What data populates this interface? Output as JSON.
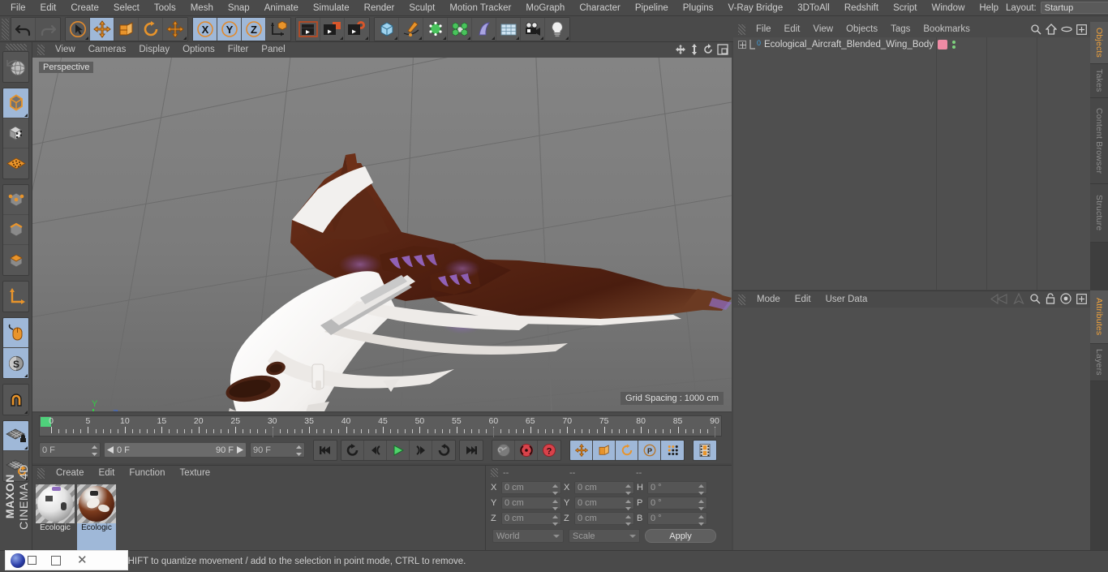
{
  "app": {
    "brand_line1": "MAXON",
    "brand_line2": "CINEMA 4D"
  },
  "menubar": {
    "items": [
      "File",
      "Edit",
      "Create",
      "Select",
      "Tools",
      "Mesh",
      "Snap",
      "Animate",
      "Simulate",
      "Render",
      "Sculpt",
      "Motion Tracker",
      "MoGraph",
      "Character",
      "Pipeline",
      "Plugins",
      "V-Ray Bridge",
      "3DToAll",
      "Redshift",
      "Script",
      "Window",
      "Help"
    ],
    "layout_label": "Layout:",
    "layout_value": "Startup",
    "search_icon": "search-icon"
  },
  "toolbar": {
    "groups": [
      {
        "name": "undo-redo",
        "buttons": [
          {
            "name": "undo-button",
            "icon": "undo-arrow-icon",
            "active": false
          },
          {
            "name": "redo-button",
            "icon": "redo-arrow-icon",
            "active": false,
            "disabled": true
          }
        ]
      },
      {
        "name": "transform-tools",
        "buttons": [
          {
            "name": "select-tool",
            "icon": "cursor-circle-icon",
            "active": false
          },
          {
            "name": "move-tool",
            "icon": "move-arrows-icon",
            "active": true
          },
          {
            "name": "scale-tool",
            "icon": "scale-box-icon",
            "active": false
          },
          {
            "name": "rotate-tool",
            "icon": "rotate-circle-icon",
            "active": false
          },
          {
            "name": "dynamic-place-tool",
            "icon": "move-arrows-icon",
            "active": false
          }
        ]
      },
      {
        "name": "axis-locks",
        "buttons": [
          {
            "name": "lock-x-axis",
            "icon": "x-axis-icon",
            "active": true
          },
          {
            "name": "lock-y-axis",
            "icon": "y-axis-icon",
            "active": true
          },
          {
            "name": "lock-z-axis",
            "icon": "z-axis-icon",
            "active": true
          },
          {
            "name": "world-object-axis",
            "icon": "world-axis-cube-icon",
            "active": false
          }
        ]
      },
      {
        "name": "render-tools",
        "buttons": [
          {
            "name": "render-view-button",
            "icon": "render-clapper-icon",
            "active": false
          },
          {
            "name": "render-to-picture-viewer-button",
            "icon": "render-picture-icon",
            "active": false
          },
          {
            "name": "render-settings-button",
            "icon": "render-gear-icon",
            "active": false
          }
        ]
      },
      {
        "name": "create-objects",
        "buttons": [
          {
            "name": "add-cube-button",
            "icon": "cube-icon",
            "active": false
          },
          {
            "name": "add-spline-button",
            "icon": "pen-spline-icon",
            "active": false
          },
          {
            "name": "add-generator-button",
            "icon": "green-cube-icon",
            "active": false
          },
          {
            "name": "add-mograph-button",
            "icon": "cloner-icon",
            "active": false
          },
          {
            "name": "add-deformer-button",
            "icon": "bend-deformer-icon",
            "active": false
          },
          {
            "name": "add-scene-object-button",
            "icon": "floor-grid-icon",
            "active": false
          },
          {
            "name": "add-camera-button",
            "icon": "camera-icon",
            "active": false
          },
          {
            "name": "add-light-button",
            "icon": "lightbulb-icon",
            "active": false
          }
        ]
      }
    ]
  },
  "left_palette": {
    "groups": [
      {
        "buttons": [
          {
            "name": "undo-view-button",
            "icon": "globe-sphere-icon",
            "active": false
          }
        ]
      },
      {
        "buttons": [
          {
            "name": "model-mode-button",
            "icon": "model-cube-icon",
            "active": true
          },
          {
            "name": "texture-mode-button",
            "icon": "texture-checker-cube-icon",
            "active": false
          },
          {
            "name": "workplane-mode-button",
            "icon": "workplane-grid-icon",
            "active": false
          }
        ]
      },
      {
        "buttons": [
          {
            "name": "points-mode-button",
            "icon": "point-cube-icon",
            "active": false
          },
          {
            "name": "edges-mode-button",
            "icon": "edge-cube-icon",
            "active": false
          },
          {
            "name": "polygons-mode-button",
            "icon": "polygon-cube-icon",
            "active": false
          }
        ]
      },
      {
        "buttons": [
          {
            "name": "object-axis-mode-button",
            "icon": "axis-l-icon",
            "active": false
          }
        ]
      },
      {
        "buttons": [
          {
            "name": "enable-axis-modification-button",
            "icon": "mouse-icon",
            "active": true
          },
          {
            "name": "soft-selection-button",
            "icon": "s-sphere-icon",
            "active": true
          }
        ]
      },
      {
        "buttons": [
          {
            "name": "magnet-tool-button",
            "icon": "magnet-icon",
            "active": false
          }
        ]
      },
      {
        "buttons": [
          {
            "name": "lock-workplane-button",
            "icon": "workplane-lock-icon",
            "active": true
          },
          {
            "name": "planar-workplane-button",
            "icon": "workplane-rotate-icon",
            "active": false
          }
        ]
      }
    ]
  },
  "viewport": {
    "menu": [
      "View",
      "Cameras",
      "Display",
      "Options",
      "Filter",
      "Panel"
    ],
    "label": "Perspective",
    "grid_spacing": "Grid Spacing : 1000 cm",
    "corner_icons": [
      "pan-icon",
      "zoom-icon",
      "rotate-icon",
      "maximize-icon"
    ],
    "axis_gizmo": {
      "x": "X",
      "y": "Y",
      "z": "Z"
    },
    "scene": {
      "object": "Ecological Aircraft Blended Wing Body",
      "body_color": "#f4f2f0",
      "accent_color": "#5d2817",
      "glow_color": "#8a5ad0",
      "background_top": "#808080",
      "background_bottom": "#6d6d6d"
    }
  },
  "timeline": {
    "ticks": [
      0,
      5,
      10,
      15,
      20,
      25,
      30,
      35,
      40,
      45,
      50,
      55,
      60,
      65,
      70,
      75,
      80,
      85,
      90
    ],
    "current_frame": "0 F",
    "range_start": "0 F",
    "range_end": "90 F",
    "end_frame": "90 F",
    "preview_frame": "0 F",
    "transport": [
      {
        "name": "go-to-start-button",
        "icon": "skip-start-icon"
      },
      {
        "name": "go-to-previous-key-button",
        "icon": "prev-key-icon"
      },
      {
        "name": "step-back-button",
        "icon": "step-back-icon"
      },
      {
        "name": "play-button",
        "icon": "play-icon"
      },
      {
        "name": "step-forward-button",
        "icon": "step-forward-icon"
      },
      {
        "name": "go-to-next-key-button",
        "icon": "next-key-icon"
      },
      {
        "name": "go-to-end-button",
        "icon": "skip-end-icon"
      }
    ],
    "record_tools": [
      {
        "name": "autokeying-button",
        "icon": "key-icon",
        "active": false
      },
      {
        "name": "record-active-objects-button",
        "icon": "record-circle-icon",
        "active": false
      },
      {
        "name": "keyframe-selection-button",
        "icon": "question-circle-icon",
        "active": false
      }
    ],
    "key_toggles": [
      {
        "name": "record-position-button",
        "icon": "move-arrows-icon",
        "active": true
      },
      {
        "name": "record-scale-button",
        "icon": "scale-box-icon",
        "active": true
      },
      {
        "name": "record-rotation-button",
        "icon": "rotate-circle-icon",
        "active": true
      },
      {
        "name": "record-pla-button",
        "icon": "p-circle-icon",
        "active": true
      },
      {
        "name": "record-point-level-animation-button",
        "icon": "dots-grid-icon",
        "active": true
      }
    ],
    "timeline_view_button": {
      "name": "timeline-toggle-button",
      "icon": "filmstrip-icon",
      "active": true
    }
  },
  "material_manager": {
    "menu": [
      "Create",
      "Edit",
      "Function",
      "Texture"
    ],
    "materials": [
      {
        "name": "Ecologic",
        "selected": false,
        "swatch": "white"
      },
      {
        "name": "Ecologic",
        "selected": true,
        "swatch": "brown"
      }
    ]
  },
  "coordinate_manager": {
    "headers": [
      "--",
      "--",
      "--"
    ],
    "rows": [
      {
        "pos_label": "X",
        "pos_value": "0 cm",
        "size_label": "X",
        "size_value": "0 cm",
        "rot_label": "H",
        "rot_value": "0 °"
      },
      {
        "pos_label": "Y",
        "pos_value": "0 cm",
        "size_label": "Y",
        "size_value": "0 cm",
        "rot_label": "P",
        "rot_value": "0 °"
      },
      {
        "pos_label": "Z",
        "pos_value": "0 cm",
        "size_label": "Z",
        "size_value": "0 cm",
        "rot_label": "B",
        "rot_value": "0 °"
      }
    ],
    "space_select": "World",
    "mode_select": "Scale",
    "apply_label": "Apply"
  },
  "object_manager": {
    "menu": [
      "File",
      "Edit",
      "View",
      "Objects",
      "Tags",
      "Bookmarks"
    ],
    "icons": [
      "search-icon",
      "home-icon",
      "ellipse-icon",
      "expand-icon"
    ],
    "items": [
      {
        "name": "Ecological_Aircraft_Blended_Wing_Body",
        "layer_badge": "0",
        "tag_color": "#f08ba5",
        "expandable": true
      }
    ]
  },
  "attribute_manager": {
    "menu": [
      "Mode",
      "Edit",
      "User Data"
    ],
    "icons": [
      "left-arrow-icon",
      "up-arrow-icon",
      "search-icon",
      "lock-icon",
      "target-icon",
      "expand-icon"
    ]
  },
  "right_tabs": {
    "top": [
      {
        "label": "Objects",
        "active": true
      },
      {
        "label": "Takes",
        "active": false
      },
      {
        "label": "Content Browser",
        "active": false
      },
      {
        "label": "Structure",
        "active": false
      }
    ],
    "bottom": [
      {
        "label": "Attributes",
        "active": true
      },
      {
        "label": "Layers",
        "active": false
      }
    ]
  },
  "statusbar": {
    "message": "move elements. Hold down SHIFT to quantize movement / add to the selection in point mode, CTRL to remove."
  },
  "window_overlay": {
    "icons": [
      "app-logo-icon",
      "restore-icon",
      "minimize-icon",
      "close-icon"
    ]
  }
}
